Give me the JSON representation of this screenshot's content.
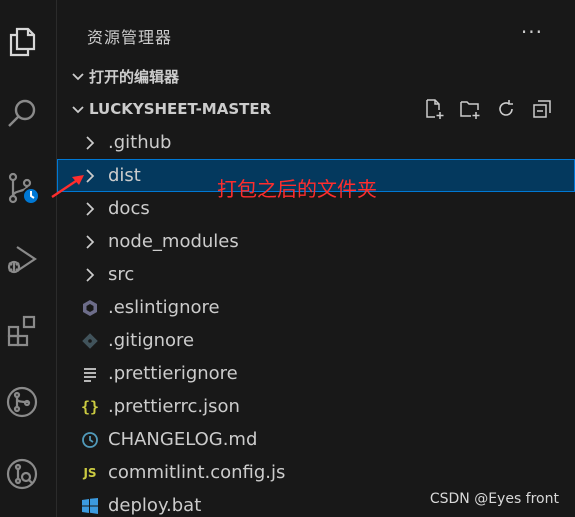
{
  "sidebar": {
    "title": "资源管理器",
    "more": "···",
    "sections": {
      "open_editors": "打开的编辑器",
      "project": "LUCKYSHEET-MASTER"
    },
    "tree": [
      {
        "label": ".github",
        "type": "folder"
      },
      {
        "label": "dist",
        "type": "folder",
        "selected": true
      },
      {
        "label": "docs",
        "type": "folder"
      },
      {
        "label": "node_modules",
        "type": "folder"
      },
      {
        "label": "src",
        "type": "folder"
      },
      {
        "label": ".eslintignore",
        "type": "file",
        "icon": "eslint-icon"
      },
      {
        "label": ".gitignore",
        "type": "file",
        "icon": "git-icon"
      },
      {
        "label": ".prettierignore",
        "type": "file",
        "icon": "lines-icon"
      },
      {
        "label": ".prettierrc.json",
        "type": "file",
        "icon": "json-braces-icon",
        "icon_text": "{}"
      },
      {
        "label": "CHANGELOG.md",
        "type": "file",
        "icon": "clock-icon"
      },
      {
        "label": "commitlint.config.js",
        "type": "file",
        "icon": "js-icon",
        "icon_text": "JS"
      },
      {
        "label": "deploy.bat",
        "type": "file",
        "icon": "windows-icon"
      }
    ]
  },
  "annotation": {
    "text": "打包之后的文件夹",
    "color": "#ff2d2d"
  },
  "watermark": "CSDN @Eyes front",
  "colors": {
    "background": "#181818",
    "selection": "#04395e",
    "selection_border": "#0078d4",
    "text": "#cccccc",
    "badge": "#0078d4"
  }
}
